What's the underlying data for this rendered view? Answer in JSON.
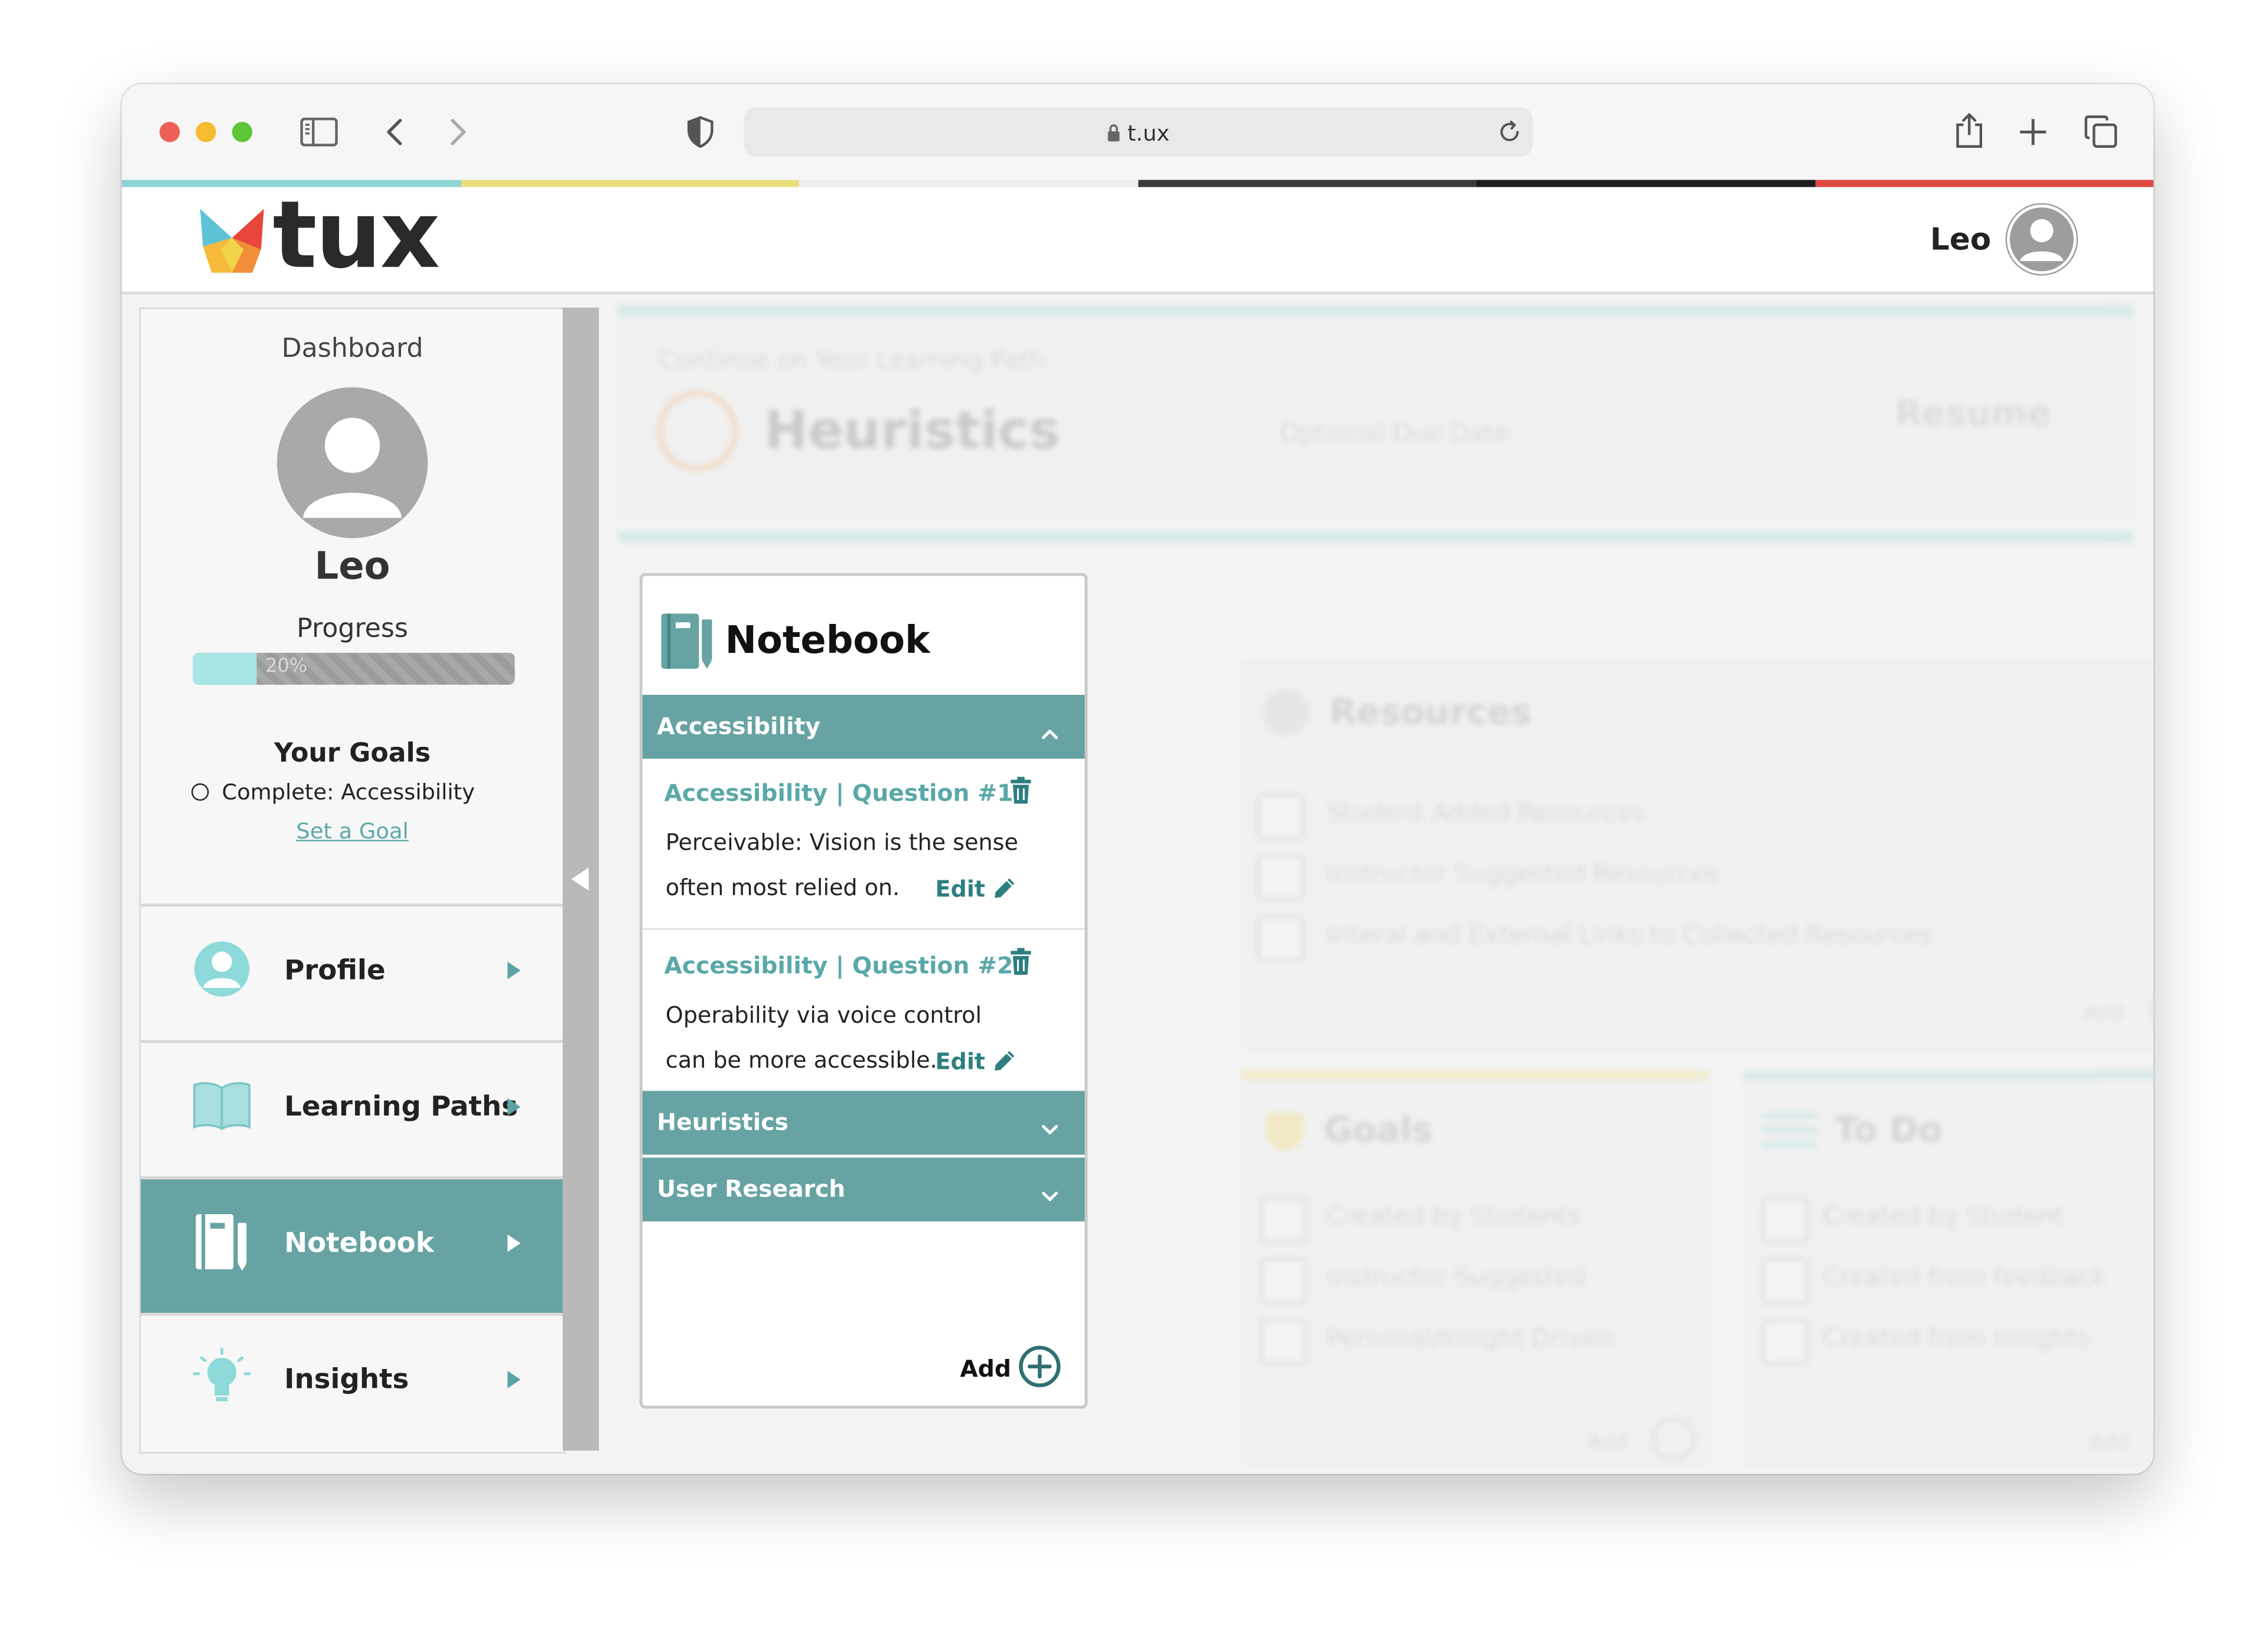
{
  "browser": {
    "url": "t.ux",
    "buttons": [
      "close",
      "minimize",
      "zoom",
      "sidebar-toggle",
      "back",
      "forward",
      "privacy-shield",
      "reload",
      "share",
      "new-tab",
      "tab-overview"
    ]
  },
  "colors": {
    "teal": "#67a3a3",
    "teal_text": "#5aa8a8",
    "light_teal": "#a8e6e6",
    "strip": [
      "#8fd4d4",
      "#eade7d",
      "#eeeeee",
      "#3a3a3a",
      "#1c1c1c",
      "#e04a45"
    ]
  },
  "header": {
    "logo_text": "tux",
    "user_name": "Leo"
  },
  "sidebar": {
    "dashboard_title": "Dashboard",
    "user_name": "Leo",
    "progress_label": "Progress",
    "progress_text": "20%",
    "progress_value": 0.2,
    "goals_title": "Your Goals",
    "goal_item": "Complete: Accessibility",
    "set_goal_link": "Set a Goal",
    "nav": [
      {
        "label": "Profile",
        "icon": "profile-icon"
      },
      {
        "label": "Learning Paths",
        "icon": "book-icon"
      },
      {
        "label": "Notebook",
        "icon": "notebook-icon",
        "active": true
      },
      {
        "label": "Insights",
        "icon": "lightbulb-icon"
      }
    ]
  },
  "background": {
    "continue_label": "Continue on Your Learning Path",
    "path_title": "Heuristics",
    "due_date": "Optional Due Date",
    "resume": "Resume",
    "resources": {
      "title": "Resources",
      "items": [
        "Student Added Resources",
        "Instructor Suggested Resources",
        "Interal and External Links to Collected Resources"
      ],
      "add": "Add"
    },
    "goals": {
      "title": "Goals",
      "items": [
        "Created by Students",
        "Instructor Suggested",
        "Personal/Insight Driven"
      ],
      "add": "Add"
    },
    "todo": {
      "title": "To Do",
      "items": [
        "Created by Student",
        "Created from feedback",
        "Created from Insights"
      ],
      "add": "Add"
    }
  },
  "notebook": {
    "title": "Notebook",
    "sections": [
      {
        "label": "Accessibility",
        "expanded": true,
        "questions": [
          {
            "title": "Accessibility | Question #1",
            "body": "Perceivable: Vision is the sense often most relied on.",
            "edit": "Edit"
          },
          {
            "title": "Accessibility | Question #2",
            "body": "Operability via voice control can be more accessible.",
            "edit": "Edit"
          }
        ]
      },
      {
        "label": "Heuristics",
        "expanded": false
      },
      {
        "label": "User Research",
        "expanded": false
      }
    ],
    "add_label": "Add"
  }
}
